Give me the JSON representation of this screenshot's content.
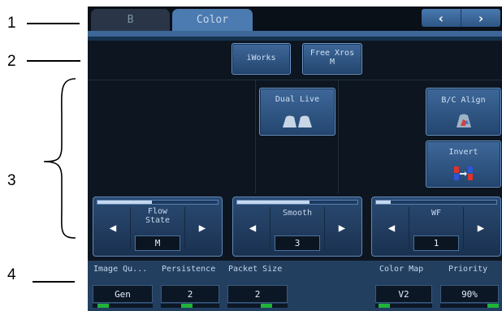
{
  "callouts": [
    "1",
    "2",
    "3",
    "4"
  ],
  "tabs": [
    {
      "label": "B",
      "active": false
    },
    {
      "label": "Color",
      "active": true
    }
  ],
  "nav": {
    "prev": "‹",
    "next": "›"
  },
  "top_buttons": {
    "iworks": "iWorks",
    "free_xros_line1": "Free Xros",
    "free_xros_line2": "M"
  },
  "buttons": {
    "dual_live": "Dual Live",
    "bc_align": "B/C Align",
    "invert": "Invert"
  },
  "knobs": [
    {
      "title_line1": "Flow",
      "title_line2": "State",
      "value": "M",
      "level": 0.45
    },
    {
      "title_line1": "Smooth",
      "title_line2": "",
      "value": "3",
      "level": 0.6
    },
    {
      "title_line1": "WF",
      "title_line2": "",
      "value": "1",
      "level": 0.12
    }
  ],
  "params": [
    {
      "name": "Image Qu...",
      "value": "Gen",
      "marker": 0.08
    },
    {
      "name": "Persistence",
      "value": "2",
      "marker": 0.35
    },
    {
      "name": "Packet Size",
      "value": "2",
      "marker": 0.55
    },
    {
      "name": "Color Map",
      "value": "V2",
      "marker": 0.05
    },
    {
      "name": "Priority",
      "value": "90%",
      "marker": 0.8
    }
  ],
  "colors": {
    "screen_bg": "#0d1620",
    "active_tab": "#4b7bb0",
    "button": "#2f5786",
    "indicator": "#20b33a"
  }
}
